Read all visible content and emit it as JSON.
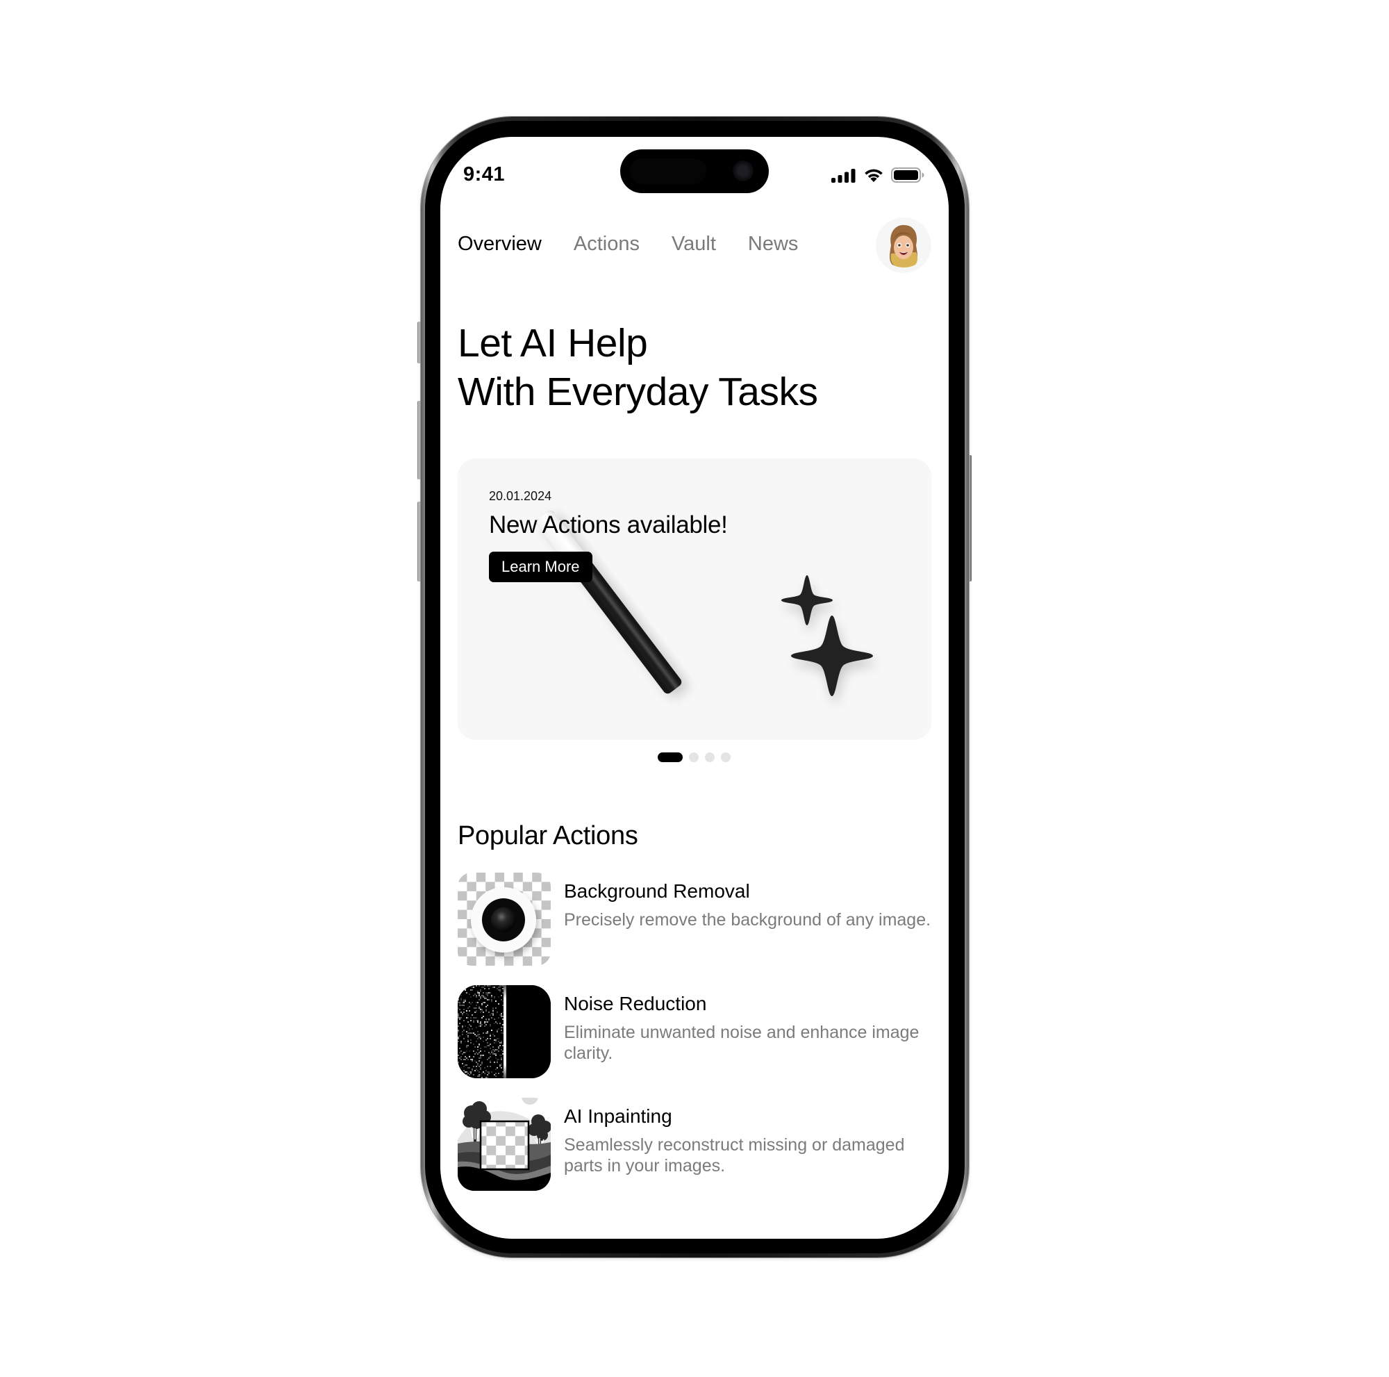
{
  "status_bar": {
    "time": "9:41",
    "icons": [
      "cellular-signal-icon",
      "wifi-icon",
      "battery-icon"
    ]
  },
  "nav": {
    "tabs": [
      {
        "label": "Overview",
        "active": true
      },
      {
        "label": "Actions",
        "active": false
      },
      {
        "label": "Vault",
        "active": false
      },
      {
        "label": "News",
        "active": false
      }
    ],
    "avatar": "memoji-avatar"
  },
  "hero": {
    "line1": "Let AI Help",
    "line2": "With Everyday Tasks"
  },
  "promo_card": {
    "date": "20.01.2024",
    "title": "New Actions available!",
    "button_label": "Learn More",
    "illustration": "magic-wand-with-sparkles",
    "carousel": {
      "total_pages": 4,
      "active_index": 0
    }
  },
  "popular_actions": {
    "title": "Popular Actions",
    "items": [
      {
        "title": "Background Removal",
        "description": "Precisely remove the background of any image.",
        "icon": "background-removal-icon"
      },
      {
        "title": "Noise Reduction",
        "description": "Eliminate unwanted noise and enhance image clarity.",
        "icon": "noise-reduction-icon"
      },
      {
        "title": "AI Inpainting",
        "description": "Seamlessly reconstruct missing or damaged parts in your images.",
        "icon": "ai-inpainting-icon"
      }
    ]
  },
  "colors": {
    "text_primary": "#000000",
    "text_secondary": "#7a7a7a",
    "card_background": "#f7f7f7",
    "button_background": "#000000",
    "dot_inactive": "#e4e4e4"
  }
}
